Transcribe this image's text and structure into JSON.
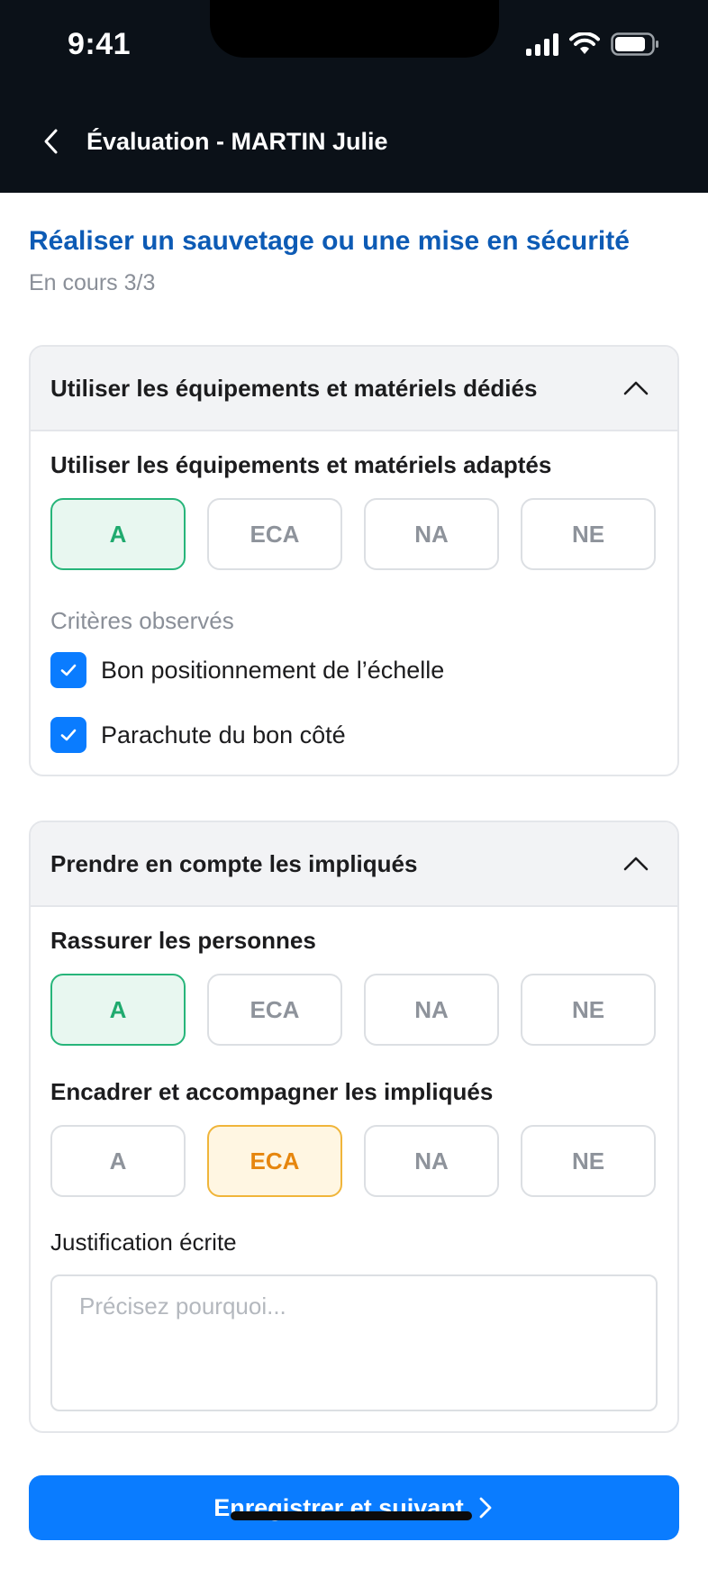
{
  "status_bar": {
    "time": "9:41"
  },
  "header": {
    "title": "Évaluation - MARTIN Julie"
  },
  "page": {
    "title": "Réaliser un sauvetage ou une mise en sécurité",
    "subtitle": "En cours 3/3"
  },
  "options": [
    "A",
    "ECA",
    "NA",
    "NE"
  ],
  "sections": [
    {
      "title": "Utiliser les équipements et matériels dédiés",
      "criterion": {
        "label": "Utiliser les équipements et matériels adaptés",
        "selected": "A"
      },
      "observed_label": "Critères observés",
      "observed": [
        {
          "label": "Bon positionnement de l’échelle",
          "checked": true
        },
        {
          "label": "Parachute du bon côté",
          "checked": true
        }
      ]
    },
    {
      "title": "Prendre en compte les impliqués",
      "criteria": [
        {
          "label": "Rassurer les personnes",
          "selected": "A"
        },
        {
          "label": "Encadrer et accompagner les impliqués",
          "selected": "ECA"
        }
      ],
      "justification": {
        "label": "Justification écrite",
        "placeholder": "Précisez pourquoi...",
        "value": ""
      }
    }
  ],
  "footer": {
    "primary_label": "Enregistrer et suivant"
  },
  "colors": {
    "header_bg": "#0b1118",
    "title_blue": "#0d5bb5",
    "primary": "#0a7cff",
    "selected_green": "#27b57a",
    "selected_orange": "#f0b53a"
  }
}
